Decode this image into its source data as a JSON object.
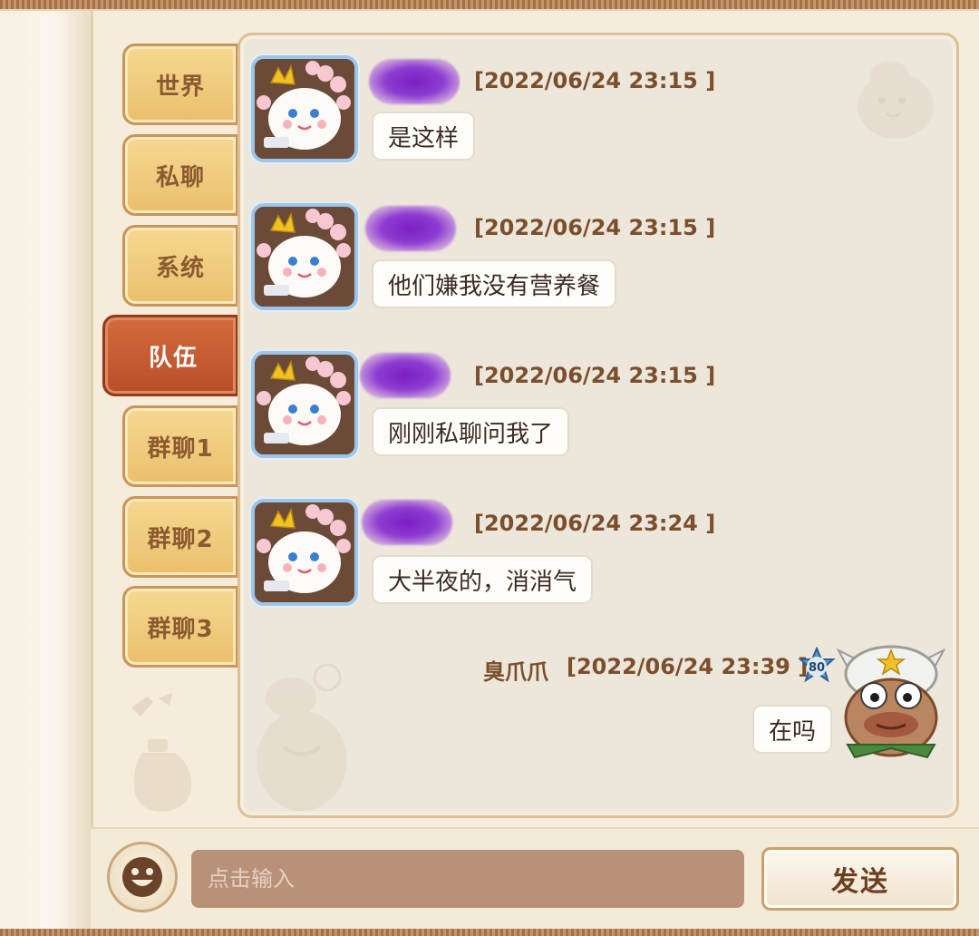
{
  "tabs": [
    {
      "label": "世界",
      "active": false
    },
    {
      "label": "私聊",
      "active": false
    },
    {
      "label": "系统",
      "active": false
    },
    {
      "label": "队伍",
      "active": true
    },
    {
      "label": "群聊1",
      "active": false
    },
    {
      "label": "群聊2",
      "active": false
    },
    {
      "label": "群聊3",
      "active": false
    }
  ],
  "messages": [
    {
      "sender_redacted": true,
      "timestamp": "[2022/06/24 23:15 ]",
      "text": "是这样"
    },
    {
      "sender_redacted": true,
      "timestamp": "[2022/06/24 23:15 ]",
      "text": "他们嫌我没有营养餐"
    },
    {
      "sender_redacted": true,
      "timestamp": "[2022/06/24 23:15 ]",
      "text": "刚刚私聊问我了"
    },
    {
      "sender_redacted": true,
      "timestamp": "[2022/06/24 23:24 ]",
      "text": "大半夜的，消消气"
    }
  ],
  "self_message": {
    "sender": "臭爪爪",
    "timestamp": "[2022/06/24 23:39 ]",
    "level": "80",
    "text": "在吗"
  },
  "input": {
    "placeholder": "点击输入",
    "value": ""
  },
  "send_label": "发送",
  "colors": {
    "tab_active": "#c95a31",
    "tab_inactive": "#eec97a",
    "panel_bg": "#ede6da",
    "name_redaction": "#7a1fc3",
    "timestamp_text": "#7b4e2c",
    "input_bg": "#b99178"
  },
  "icons": {
    "emoji_button": "smiley-face-icon",
    "other_avatar": "cream-bun-crown-avatar-icon",
    "self_avatar": "cow-avatar-icon",
    "level_badge": "star-badge-icon"
  }
}
